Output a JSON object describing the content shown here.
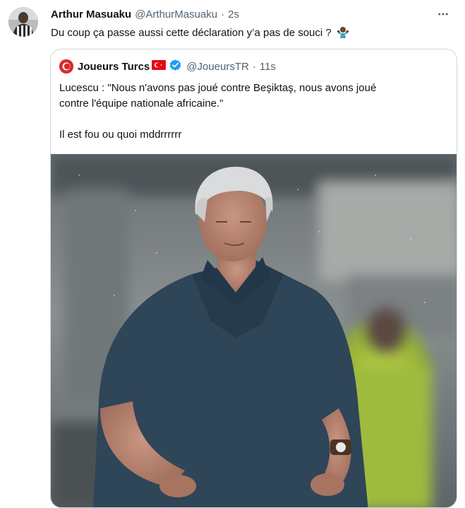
{
  "tweet": {
    "author_name": "Arthur Masuaku",
    "author_handle": "@ArthurMasuaku",
    "separator": "·",
    "time": "2s",
    "text": "Du coup ça passe aussi cette déclaration y’a pas de souci ?",
    "emoji_icon": "person-shrugging-emoji",
    "more_icon": "more-horizontal-icon"
  },
  "quoted": {
    "author_name": "Joueurs Turcs",
    "flag_icon": "turkey-flag-icon",
    "verified_icon": "verified-badge-icon",
    "author_handle": "@JoueursTR",
    "separator": "·",
    "time": "11s",
    "lines": [
      "Lucescu : \"Nous n'avons pas joué contre Beşiktaş, nous avons joué",
      "contre l'équipe nationale africaine.\""
    ],
    "line3": "Il est fou ou quoi mddrrrrrr",
    "image_icon": "photo-of-coach-image"
  },
  "colors": {
    "text": "#0f1419",
    "secondary": "#536471",
    "border": "#cfd9de",
    "verified": "#1d9bf0",
    "flag_red": "#e30a17"
  }
}
